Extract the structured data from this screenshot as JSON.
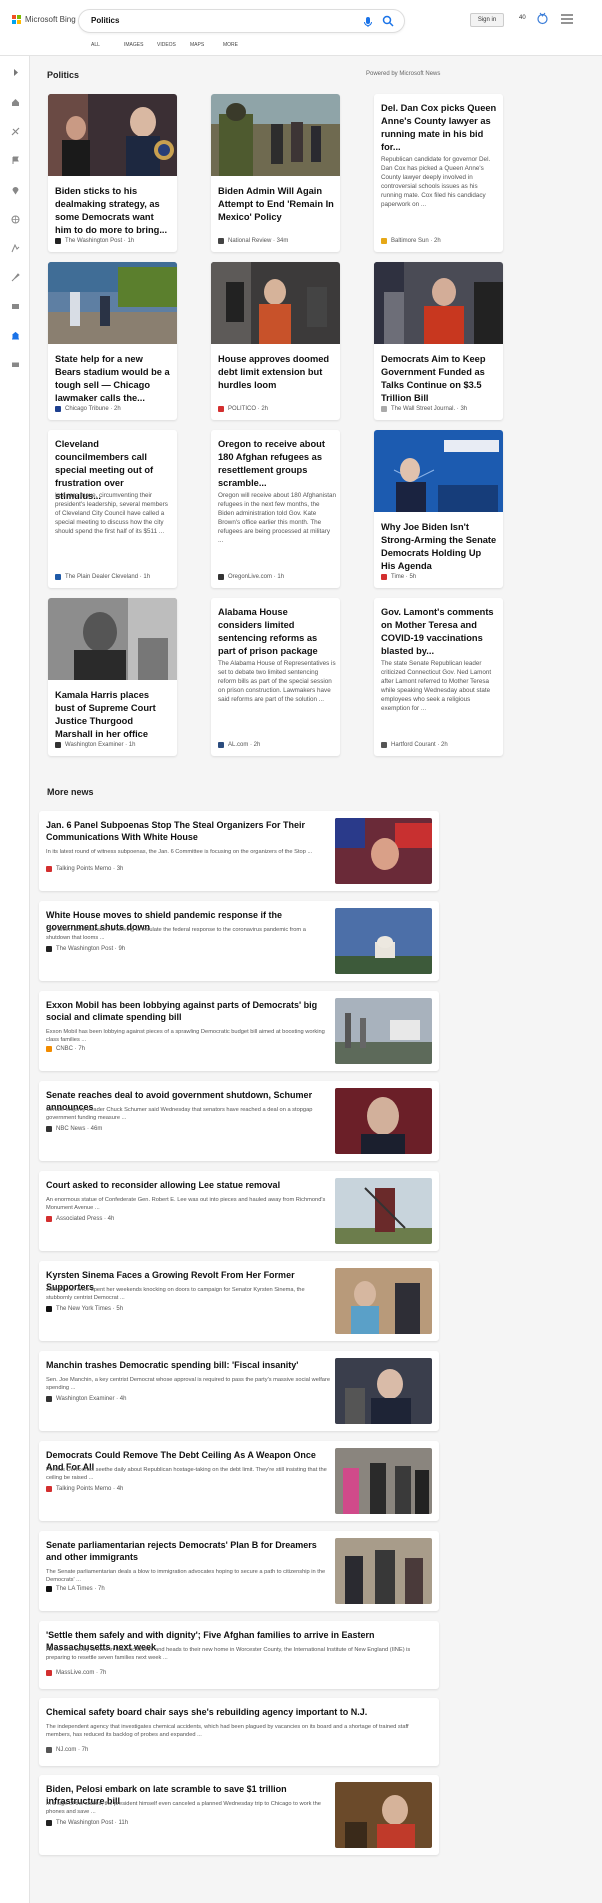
{
  "header": {
    "brand": "Microsoft Bing",
    "query": "Politics",
    "signin_label": "Sign in",
    "points": "40",
    "tabs": [
      "ALL",
      "IMAGES",
      "VIDEOS",
      "MAPS",
      "MORE"
    ]
  },
  "section_title": "Politics",
  "powered_by": "Powered by Microsoft News",
  "cards": [
    {
      "title": "Biden sticks to his dealmaking strategy, as some Democrats want him to do more to bring...",
      "desc": "",
      "source": "The Washington Post · 1h",
      "has_image": true
    },
    {
      "title": "Biden Admin Will Again Attempt to End 'Remain In Mexico' Policy",
      "desc": "",
      "source": "National Review · 34m",
      "has_image": true
    },
    {
      "title": "Del. Dan Cox picks Queen Anne's County lawyer as running mate in his bid for...",
      "desc": "Republican candidate for governor Del. Dan Cox has picked a Queen Anne's County lawyer deeply involved in controversial schools issues as his running mate. Cox filed his candidacy paperwork on ...",
      "source": "Baltimore Sun · 2h",
      "has_image": false
    },
    {
      "title": "State help for a new Bears stadium would be a tough sell — Chicago lawmaker calls the...",
      "desc": "",
      "source": "Chicago Tribune · 2h",
      "has_image": true
    },
    {
      "title": "House approves doomed debt limit extension but hurdles loom",
      "desc": "",
      "source": "POLITICO · 2h",
      "has_image": true
    },
    {
      "title": "Democrats Aim to Keep Government Funded as Talks Continue on $3.5 Trillion Bill",
      "desc": "",
      "source": "The Wall Street Journal. · 3h",
      "has_image": true
    },
    {
      "title": "Cleveland councilmembers call special meeting out of frustration over stimulus...",
      "desc": "In a rare move, circumventing their president's leadership, several members of Cleveland City Council have called a special meeting to discuss how the city should spend the first half of its $511 ...",
      "source": "The Plain Dealer Cleveland · 1h",
      "has_image": false
    },
    {
      "title": "Oregon to receive about 180 Afghan refugees as resettlement groups scramble...",
      "desc": "Oregon will receive about 180 Afghanistan refugees in the next few months, the Biden administration told Gov. Kate Brown's office earlier this month. The refugees are being processed at military ...",
      "source": "OregonLive.com · 1h",
      "has_image": false
    },
    {
      "title": "Why Joe Biden Isn't Strong-Arming the Senate Democrats Holding Up His Agenda",
      "desc": "",
      "source": "Time · 5h",
      "has_image": true
    },
    {
      "title": "Kamala Harris places bust of Supreme Court Justice Thurgood Marshall in her office",
      "desc": "",
      "source": "Washington Examiner · 1h",
      "has_image": true
    },
    {
      "title": "Alabama House considers limited sentencing reforms as part of prison package",
      "desc": "The Alabama House of Representatives is set to debate two limited sentencing reform bills as part of the special session on prison construction. Lawmakers have said reforms are part of the solution ...",
      "source": "AL.com · 2h",
      "has_image": false
    },
    {
      "title": "Gov. Lamont's comments on Mother Teresa and COVID-19 vaccinations blasted by...",
      "desc": "The state Senate Republican leader criticized Connecticut Gov. Ned Lamont after Lamont referred to Mother Teresa while speaking Wednesday about state employees who seek a religious exemption for ...",
      "source": "Hartford Courant · 2h",
      "has_image": false
    }
  ],
  "more_title": "More news",
  "more_news": [
    {
      "title": "Jan. 6 Panel Subpoenas Stop The Steal Organizers For Their Communications With White House",
      "desc": "In its latest round of witness subpoenas, the Jan. 6 Committee is focusing on the organizers of the Stop ...",
      "source": "Talking Points Memo · 3h",
      "has_image": true
    },
    {
      "title": "White House moves to shield pandemic response if the government shuts down",
      "desc": "The Biden administration is striving to insulate the federal response to the coronavirus pandemic from a shutdown that looms ...",
      "source": "The Washington Post · 9h",
      "has_image": true
    },
    {
      "title": "Exxon Mobil has been lobbying against parts of Democrats' big social and climate spending bill",
      "desc": "Exxon Mobil has been lobbying against pieces of a sprawling Democratic budget bill aimed at boosting working class families ...",
      "source": "CNBC · 7h",
      "has_image": true
    },
    {
      "title": "Senate reaches deal to avoid government shutdown, Schumer announces",
      "desc": "Senate Majority Leader Chuck Schumer said Wednesday that senators have reached a deal on a stopgap government funding measure ...",
      "source": "NBC News · 46m",
      "has_image": true
    },
    {
      "title": "Court asked to reconsider allowing Lee statue removal",
      "desc": "An enormous statue of Confederate Gen. Robert E. Lee was out into pieces and hauled away from Richmond's Monument Avenue ...",
      "source": "Associated Press · 4h",
      "has_image": true
    },
    {
      "title": "Kyrsten Sinema Faces a Growing Revolt From Her Former Supporters",
      "desc": "Jade Duran once spent her weekends knocking on doors to campaign for Senator Kyrsten Sinema, the stubbornly centrist Democrat ...",
      "source": "The New York Times · 5h",
      "has_image": true
    },
    {
      "title": "Manchin trashes Democratic spending bill: 'Fiscal insanity'",
      "desc": "Sen. Joe Manchin, a key centrist Democrat whose approval is required to pass the party's massive social welfare spending ...",
      "source": "Washington Examiner · 4h",
      "has_image": true
    },
    {
      "title": "Democrats Could Remove The Debt Ceiling As A Weapon Once And For All",
      "desc": "Furious Democrats seethe daily about Republican hostage-taking on the debt limit. They're still insisting that the ceiling be raised ...",
      "source": "Talking Points Memo · 4h",
      "has_image": true
    },
    {
      "title": "Senate parliamentarian rejects Democrats' Plan B for Dreamers and other immigrants",
      "desc": "The Senate parliamentarian deals a blow to immigration advocates hoping to secure a path to citizenship in the Democrats' ...",
      "source": "The LA Times · 7h",
      "has_image": true
    },
    {
      "title": "'Settle them safely and with dignity'; Five Afghan families to arrive in Eastern Massachusetts next week",
      "desc": "As the first family arrives in Massachusetts and heads to their new home in Worcester County, the International Institute of New England (IINE) is preparing to resettle seven families next week ...",
      "source": "MassLive.com · 7h",
      "has_image": false
    },
    {
      "title": "Chemical safety board chair says she's rebuilding agency important to N.J.",
      "desc": "The independent agency that investigates chemical accidents, which had been plagued by vacancies on its board and a shortage of trained staff members, has reduced its backlog of probes and expanded ...",
      "source": "NJ.com · 7h",
      "has_image": false
    },
    {
      "title": "Biden, Pelosi embark on late scramble to save $1 trillion infrastructure bill",
      "desc": "In a sign of the stakes, the president himself even canceled a planned Wednesday trip to Chicago to work the phones and save ...",
      "source": "The Washington Post · 11h",
      "has_image": true
    }
  ]
}
